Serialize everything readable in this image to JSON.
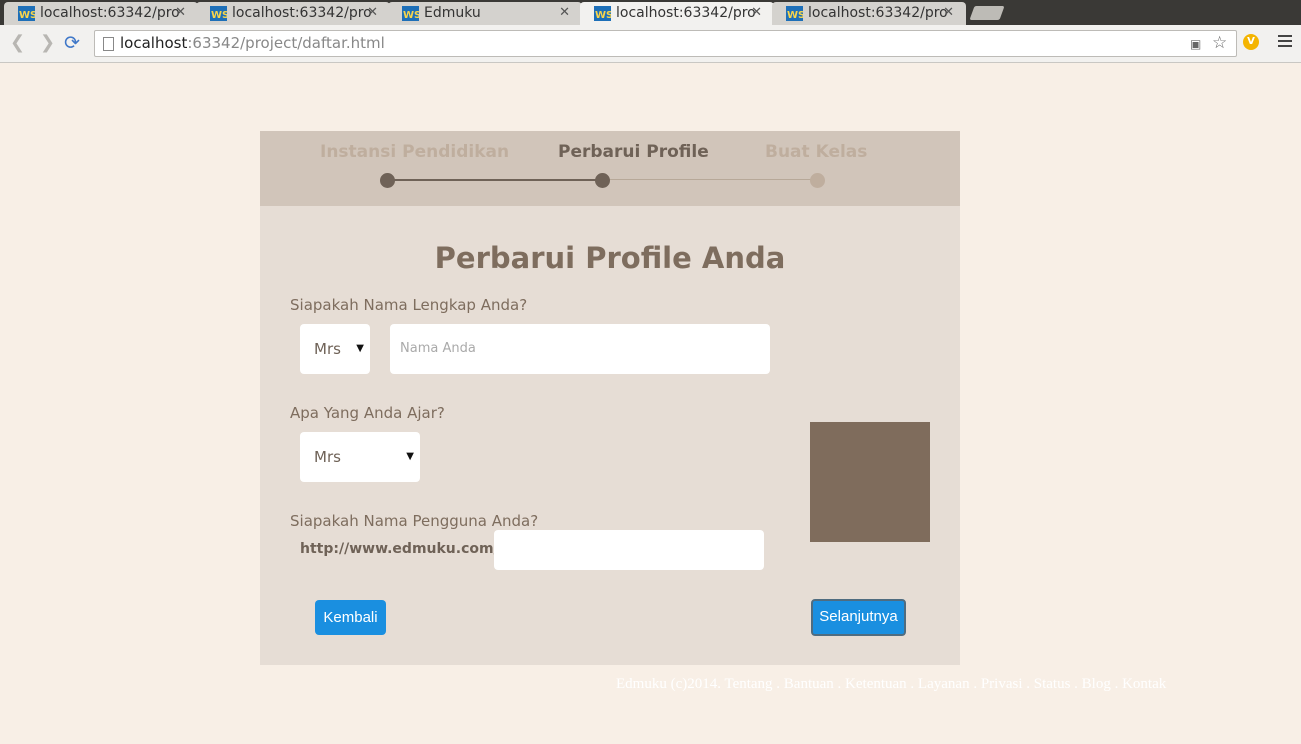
{
  "browser": {
    "tabs": [
      {
        "title": "localhost:63342/pro",
        "active": false
      },
      {
        "title": "localhost:63342/pro",
        "active": false
      },
      {
        "title": "Edmuku",
        "active": false
      },
      {
        "title": "localhost:63342/pro",
        "active": true
      },
      {
        "title": "localhost:63342/pro",
        "active": false
      }
    ],
    "url_host": "localhost",
    "url_rest": ":63342/project/daftar.html",
    "icons": [
      "back-icon",
      "forward-icon",
      "reload-icon",
      "page-icon",
      "translate-icon",
      "star-icon",
      "extension-icon",
      "menu-icon"
    ]
  },
  "wizard": {
    "steps": [
      {
        "label": "Instansi Pendidikan",
        "state": "done"
      },
      {
        "label": "Perbarui Profile",
        "state": "current"
      },
      {
        "label": "Buat Kelas",
        "state": "pending"
      }
    ],
    "title": "Perbarui Profile Anda",
    "q_name": "Siapakah Nama Lengkap Anda?",
    "salutation_value": "Mrs",
    "name_placeholder": "Nama Anda",
    "q_subject": "Apa Yang Anda Ajar?",
    "subject_value": "Mrs",
    "q_username": "Siapakah Nama Pengguna Anda?",
    "url_prefix": "http://www.edmuku.com/",
    "username_value": "",
    "back_label": "Kembali",
    "next_label": "Selanjutnya"
  },
  "footer": {
    "text": "Edmuku (c)2014. Tentang . Bantuan . Ketentuan . Layanan . Privasi . Status . Blog . Kontak"
  },
  "colors": {
    "page_bg": "#f8efe6",
    "card_bg": "#e6ddd5",
    "steps_bg": "#d1c5ba",
    "accent_brown": "#7f6c5c",
    "button_blue": "#1a8fe0"
  }
}
